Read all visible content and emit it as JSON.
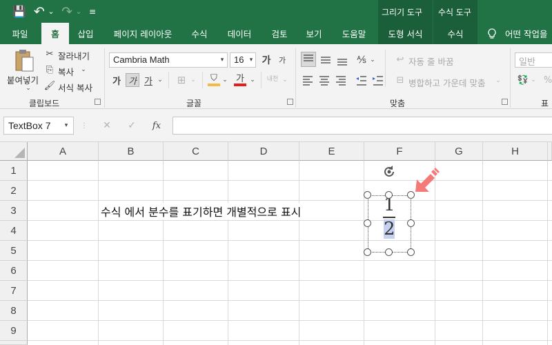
{
  "quick_access": {
    "save_icon": "💾",
    "undo_icon": "↶",
    "redo_icon": "↷",
    "customize_icon": "≡",
    "undo_dropdown": "⌄",
    "redo_dropdown": "⌄"
  },
  "context_tabs": [
    "그리기 도구",
    "수식 도구"
  ],
  "tabs": [
    "파일",
    "홈",
    "삽입",
    "페이지 레이아웃",
    "수식",
    "데이터",
    "검토",
    "보기",
    "도움말",
    "도형 서식",
    "수식"
  ],
  "tell_me": "어떤 작업을",
  "clipboard": {
    "paste": "붙여넣기",
    "cut": "잘라내기",
    "copy": "복사",
    "format_painter": "서식 복사",
    "group": "클립보드"
  },
  "font": {
    "name": "Cambria Math",
    "size": "16",
    "grow": "가",
    "shrink": "가",
    "bold": "가",
    "italic": "가",
    "underline": "가",
    "color_letter": "가",
    "phonetic": "내천",
    "group": "글꼴"
  },
  "alignment": {
    "wrap_text": "자동 줄 바꿈",
    "merge_center": "병합하고 가운데 맞춤",
    "group": "맞춤"
  },
  "number": {
    "format": "일반",
    "group": "표시"
  },
  "formula_bar": {
    "name_box": "TextBox 7",
    "cancel": "✕",
    "enter": "✓",
    "fx": "fx",
    "value": ""
  },
  "columns": [
    "A",
    "B",
    "C",
    "D",
    "E",
    "F",
    "G",
    "H"
  ],
  "rows": [
    "1",
    "2",
    "3",
    "4",
    "5",
    "6",
    "7",
    "8",
    "9"
  ],
  "sheet": {
    "b3_text": "수식 에서 분수를 표기하면 개별적으로 표시"
  },
  "textbox": {
    "numerator": "1",
    "denominator": "2"
  },
  "colors": {
    "accent": "#217346",
    "arrow": "#f47a7a",
    "selection": "#c6d0ef"
  }
}
